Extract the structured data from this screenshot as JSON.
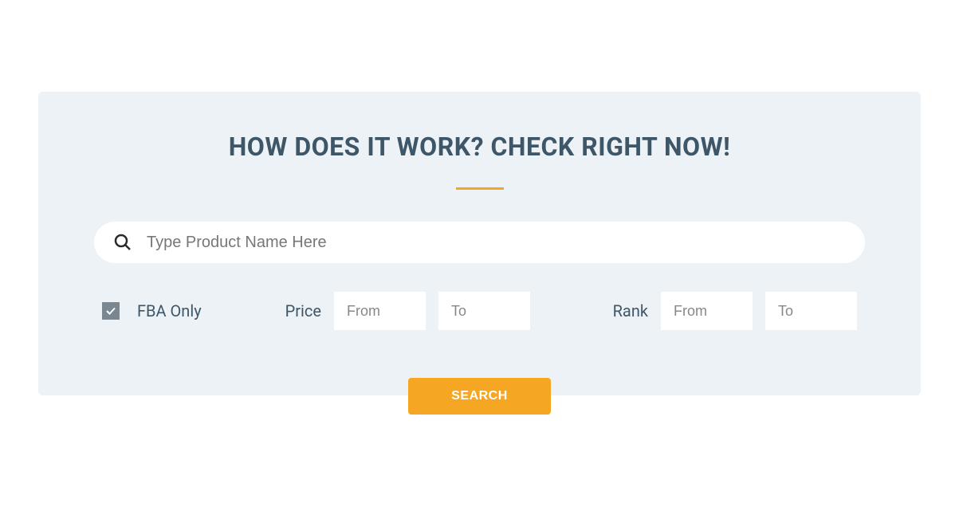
{
  "heading": "HOW DOES IT WORK? CHECK RIGHT NOW!",
  "search": {
    "placeholder": "Type Product Name Here"
  },
  "filters": {
    "fba_label": "FBA Only",
    "fba_checked": true,
    "price_label": "Price",
    "price_from_placeholder": "From",
    "price_to_placeholder": "To",
    "rank_label": "Rank",
    "rank_from_placeholder": "From",
    "rank_to_placeholder": "To"
  },
  "button": {
    "label": "SEARCH"
  },
  "colors": {
    "accent": "#f5a623",
    "panel_bg": "#edf2f6",
    "text": "#3e5768"
  }
}
